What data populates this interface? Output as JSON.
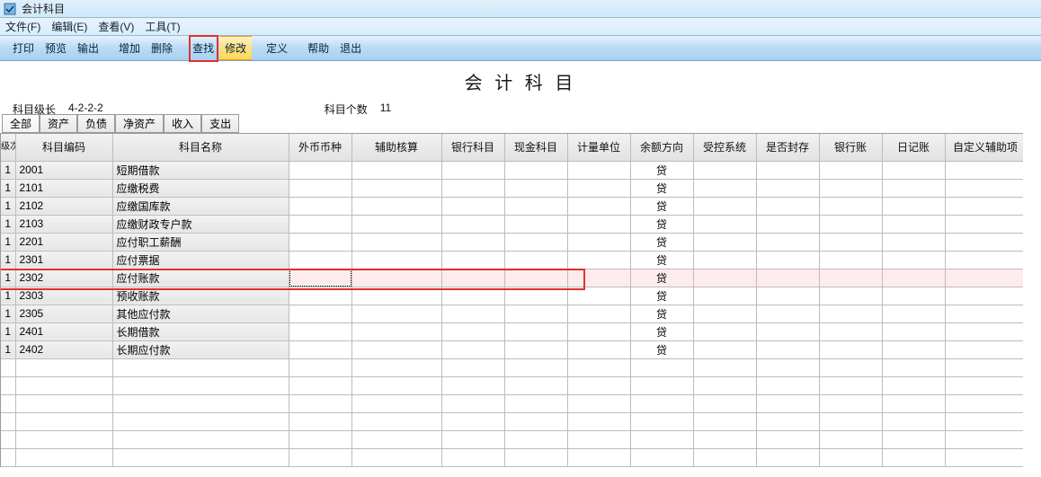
{
  "window": {
    "title": "会计科目"
  },
  "menus": {
    "file": "文件(F)",
    "edit": "编辑(E)",
    "view": "查看(V)",
    "tool": "工具(T)"
  },
  "toolbar": {
    "print": "打印",
    "preview": "预览",
    "output": "输出",
    "add": "增加",
    "delete": "删除",
    "find": "查找",
    "modify": "修改",
    "define": "定义",
    "help": "帮助",
    "exit": "退出"
  },
  "main_title": "会 计 科 目",
  "info": {
    "level_len_label": "科目级长",
    "level_len_value": "4-2-2-2",
    "count_label": "科目个数",
    "count_value": "11"
  },
  "tabs": {
    "all": "全部",
    "asset": "资产",
    "debt": "负债",
    "net": "净资产",
    "income": "收入",
    "expend": "支出"
  },
  "columns": {
    "level": "级次",
    "code": "科目编码",
    "name": "科目名称",
    "currency": "外币币种",
    "aux": "辅助核算",
    "bank": "银行科目",
    "cash": "现金科目",
    "unit": "计量单位",
    "dir": "余额方向",
    "ctrl": "受控系统",
    "sealed": "是否封存",
    "bankbook": "银行账",
    "journal": "日记账",
    "custom": "自定义辅助项"
  },
  "rows": [
    {
      "level": "1",
      "code": "2001",
      "name": "短期借款",
      "dir": "贷"
    },
    {
      "level": "1",
      "code": "2101",
      "name": "应缴税费",
      "dir": "贷"
    },
    {
      "level": "1",
      "code": "2102",
      "name": "应缴国库款",
      "dir": "贷"
    },
    {
      "level": "1",
      "code": "2103",
      "name": "应缴财政专户款",
      "dir": "贷"
    },
    {
      "level": "1",
      "code": "2201",
      "name": "应付职工薪酬",
      "dir": "贷"
    },
    {
      "level": "1",
      "code": "2301",
      "name": "应付票据",
      "dir": "贷"
    },
    {
      "level": "1",
      "code": "2302",
      "name": "应付账款",
      "dir": "贷",
      "selected": true
    },
    {
      "level": "1",
      "code": "2303",
      "name": "预收账款",
      "dir": "贷"
    },
    {
      "level": "1",
      "code": "2305",
      "name": "其他应付款",
      "dir": "贷"
    },
    {
      "level": "1",
      "code": "2401",
      "name": "长期借款",
      "dir": "贷"
    },
    {
      "level": "1",
      "code": "2402",
      "name": "长期应付款",
      "dir": "贷"
    }
  ]
}
